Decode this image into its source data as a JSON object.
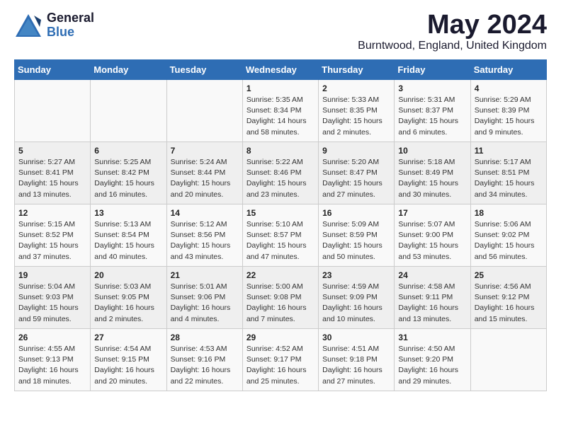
{
  "logo": {
    "general": "General",
    "blue": "Blue"
  },
  "header": {
    "month": "May 2024",
    "location": "Burntwood, England, United Kingdom"
  },
  "weekdays": [
    "Sunday",
    "Monday",
    "Tuesday",
    "Wednesday",
    "Thursday",
    "Friday",
    "Saturday"
  ],
  "weeks": [
    [
      {
        "day": "",
        "content": ""
      },
      {
        "day": "",
        "content": ""
      },
      {
        "day": "",
        "content": ""
      },
      {
        "day": "1",
        "content": "Sunrise: 5:35 AM\nSunset: 8:34 PM\nDaylight: 14 hours\nand 58 minutes."
      },
      {
        "day": "2",
        "content": "Sunrise: 5:33 AM\nSunset: 8:35 PM\nDaylight: 15 hours\nand 2 minutes."
      },
      {
        "day": "3",
        "content": "Sunrise: 5:31 AM\nSunset: 8:37 PM\nDaylight: 15 hours\nand 6 minutes."
      },
      {
        "day": "4",
        "content": "Sunrise: 5:29 AM\nSunset: 8:39 PM\nDaylight: 15 hours\nand 9 minutes."
      }
    ],
    [
      {
        "day": "5",
        "content": "Sunrise: 5:27 AM\nSunset: 8:41 PM\nDaylight: 15 hours\nand 13 minutes."
      },
      {
        "day": "6",
        "content": "Sunrise: 5:25 AM\nSunset: 8:42 PM\nDaylight: 15 hours\nand 16 minutes."
      },
      {
        "day": "7",
        "content": "Sunrise: 5:24 AM\nSunset: 8:44 PM\nDaylight: 15 hours\nand 20 minutes."
      },
      {
        "day": "8",
        "content": "Sunrise: 5:22 AM\nSunset: 8:46 PM\nDaylight: 15 hours\nand 23 minutes."
      },
      {
        "day": "9",
        "content": "Sunrise: 5:20 AM\nSunset: 8:47 PM\nDaylight: 15 hours\nand 27 minutes."
      },
      {
        "day": "10",
        "content": "Sunrise: 5:18 AM\nSunset: 8:49 PM\nDaylight: 15 hours\nand 30 minutes."
      },
      {
        "day": "11",
        "content": "Sunrise: 5:17 AM\nSunset: 8:51 PM\nDaylight: 15 hours\nand 34 minutes."
      }
    ],
    [
      {
        "day": "12",
        "content": "Sunrise: 5:15 AM\nSunset: 8:52 PM\nDaylight: 15 hours\nand 37 minutes."
      },
      {
        "day": "13",
        "content": "Sunrise: 5:13 AM\nSunset: 8:54 PM\nDaylight: 15 hours\nand 40 minutes."
      },
      {
        "day": "14",
        "content": "Sunrise: 5:12 AM\nSunset: 8:56 PM\nDaylight: 15 hours\nand 43 minutes."
      },
      {
        "day": "15",
        "content": "Sunrise: 5:10 AM\nSunset: 8:57 PM\nDaylight: 15 hours\nand 47 minutes."
      },
      {
        "day": "16",
        "content": "Sunrise: 5:09 AM\nSunset: 8:59 PM\nDaylight: 15 hours\nand 50 minutes."
      },
      {
        "day": "17",
        "content": "Sunrise: 5:07 AM\nSunset: 9:00 PM\nDaylight: 15 hours\nand 53 minutes."
      },
      {
        "day": "18",
        "content": "Sunrise: 5:06 AM\nSunset: 9:02 PM\nDaylight: 15 hours\nand 56 minutes."
      }
    ],
    [
      {
        "day": "19",
        "content": "Sunrise: 5:04 AM\nSunset: 9:03 PM\nDaylight: 15 hours\nand 59 minutes."
      },
      {
        "day": "20",
        "content": "Sunrise: 5:03 AM\nSunset: 9:05 PM\nDaylight: 16 hours\nand 2 minutes."
      },
      {
        "day": "21",
        "content": "Sunrise: 5:01 AM\nSunset: 9:06 PM\nDaylight: 16 hours\nand 4 minutes."
      },
      {
        "day": "22",
        "content": "Sunrise: 5:00 AM\nSunset: 9:08 PM\nDaylight: 16 hours\nand 7 minutes."
      },
      {
        "day": "23",
        "content": "Sunrise: 4:59 AM\nSunset: 9:09 PM\nDaylight: 16 hours\nand 10 minutes."
      },
      {
        "day": "24",
        "content": "Sunrise: 4:58 AM\nSunset: 9:11 PM\nDaylight: 16 hours\nand 13 minutes."
      },
      {
        "day": "25",
        "content": "Sunrise: 4:56 AM\nSunset: 9:12 PM\nDaylight: 16 hours\nand 15 minutes."
      }
    ],
    [
      {
        "day": "26",
        "content": "Sunrise: 4:55 AM\nSunset: 9:13 PM\nDaylight: 16 hours\nand 18 minutes."
      },
      {
        "day": "27",
        "content": "Sunrise: 4:54 AM\nSunset: 9:15 PM\nDaylight: 16 hours\nand 20 minutes."
      },
      {
        "day": "28",
        "content": "Sunrise: 4:53 AM\nSunset: 9:16 PM\nDaylight: 16 hours\nand 22 minutes."
      },
      {
        "day": "29",
        "content": "Sunrise: 4:52 AM\nSunset: 9:17 PM\nDaylight: 16 hours\nand 25 minutes."
      },
      {
        "day": "30",
        "content": "Sunrise: 4:51 AM\nSunset: 9:18 PM\nDaylight: 16 hours\nand 27 minutes."
      },
      {
        "day": "31",
        "content": "Sunrise: 4:50 AM\nSunset: 9:20 PM\nDaylight: 16 hours\nand 29 minutes."
      },
      {
        "day": "",
        "content": ""
      }
    ]
  ]
}
